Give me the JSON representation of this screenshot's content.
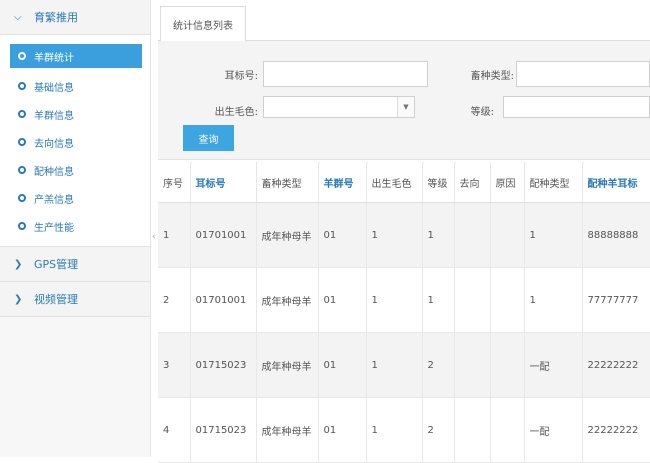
{
  "sidebar": {
    "group1": {
      "title": "育繁推用",
      "items": [
        {
          "label": "羊群统计",
          "active": true
        },
        {
          "label": "基础信息"
        },
        {
          "label": "羊群信息"
        },
        {
          "label": "去向信息"
        },
        {
          "label": "配种信息"
        },
        {
          "label": "产羔信息"
        },
        {
          "label": "生产性能"
        }
      ]
    },
    "group2": {
      "title": "GPS管理"
    },
    "group3": {
      "title": "视频管理"
    }
  },
  "tab": {
    "label": "统计信息列表"
  },
  "form": {
    "ear_tag_label": "耳标号:",
    "ear_tag_value": "",
    "breed_type_label": "畜种类型:",
    "breed_type_value": "",
    "birth_color_label": "出生毛色:",
    "birth_color_value": "",
    "grade_label": "等级:",
    "grade_value": "",
    "query_button": "查询"
  },
  "table": {
    "headers": [
      "序号",
      "耳标号",
      "畜种类型",
      "羊群号",
      "出生毛色",
      "等级",
      "去向",
      "原因",
      "配种类型",
      "配种羊耳标"
    ],
    "rows": [
      [
        "1",
        "01701001",
        "成年种母羊",
        "01",
        "1",
        "1",
        "",
        "",
        "1",
        "88888888"
      ],
      [
        "2",
        "01701001",
        "成年种母羊",
        "01",
        "1",
        "1",
        "",
        "",
        "1",
        "77777777"
      ],
      [
        "3",
        "01715023",
        "成年种母羊",
        "01",
        "1",
        "2",
        "",
        "",
        "一配",
        "22222222"
      ],
      [
        "4",
        "01715023",
        "成年种母羊",
        "01",
        "1",
        "2",
        "",
        "",
        "一配",
        "22222222"
      ]
    ]
  },
  "colors": {
    "accent": "#3b9fdd",
    "link": "#2a7ab7"
  },
  "icons": {
    "expanded": "chevron-down-icon",
    "collapsed": "chevron-right-icon",
    "item": "circle-icon"
  }
}
